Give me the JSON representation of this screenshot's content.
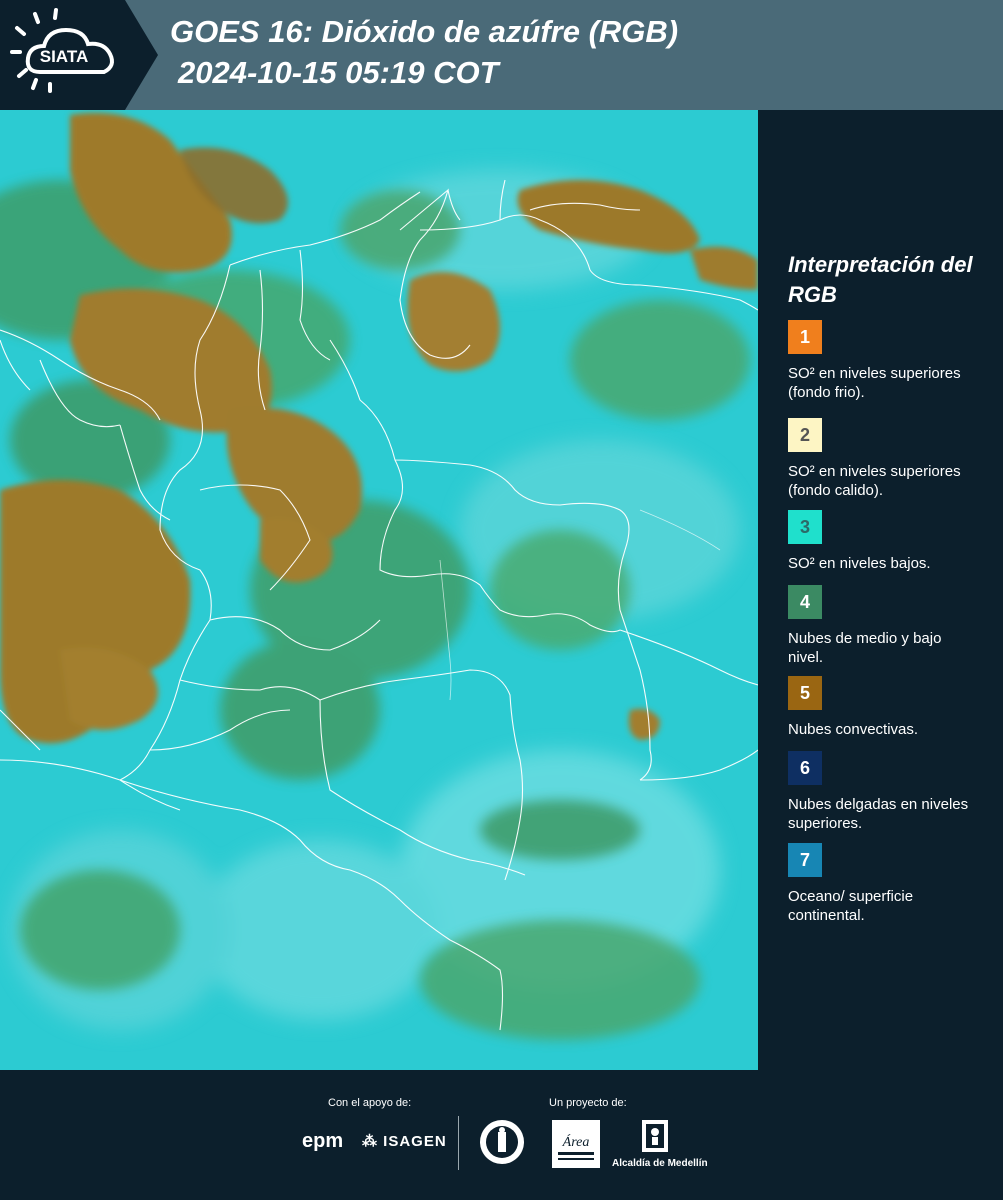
{
  "header": {
    "logo_text": "SIATA",
    "title_line1": "GOES 16: Dióxido de azúfre (RGB)",
    "title_line2": "2024-10-15 05:19 COT",
    "bg_color": "#4a6a78"
  },
  "legend": {
    "title": "Interpretación del RGB",
    "items": [
      {
        "number": "1",
        "color": "#f07f1d",
        "text": "SO² en niveles superiores (fondo frio)."
      },
      {
        "number": "2",
        "color": "#fdf5c4",
        "text": "SO² en niveles superiores (fondo calido)."
      },
      {
        "number": "3",
        "color": "#1fe0cc",
        "text": "SO² en niveles bajos."
      },
      {
        "number": "4",
        "color": "#3b8a63",
        "text": "Nubes de medio y bajo nivel."
      },
      {
        "number": "5",
        "color": "#9a6612",
        "text": "Nubes convectivas."
      },
      {
        "number": "6",
        "color": "#0e2f62",
        "text": "Nubes delgadas en niveles superiores."
      },
      {
        "number": "7",
        "color": "#1786b4",
        "text": "Oceano/ superficie continental."
      }
    ]
  },
  "footer": {
    "support_label": "Con el apoyo de:",
    "project_label": "Un proyecto de:",
    "epm_logo_text": "epm",
    "isagen_logo_text": "ISAGEN",
    "area_logo_text": "Área",
    "alcaldia_label": "Alcaldía de Medellín"
  },
  "icons": [
    "sun-cloud-icon",
    "isagen-icon",
    "seal-icon",
    "coat-of-arms-icon"
  ]
}
